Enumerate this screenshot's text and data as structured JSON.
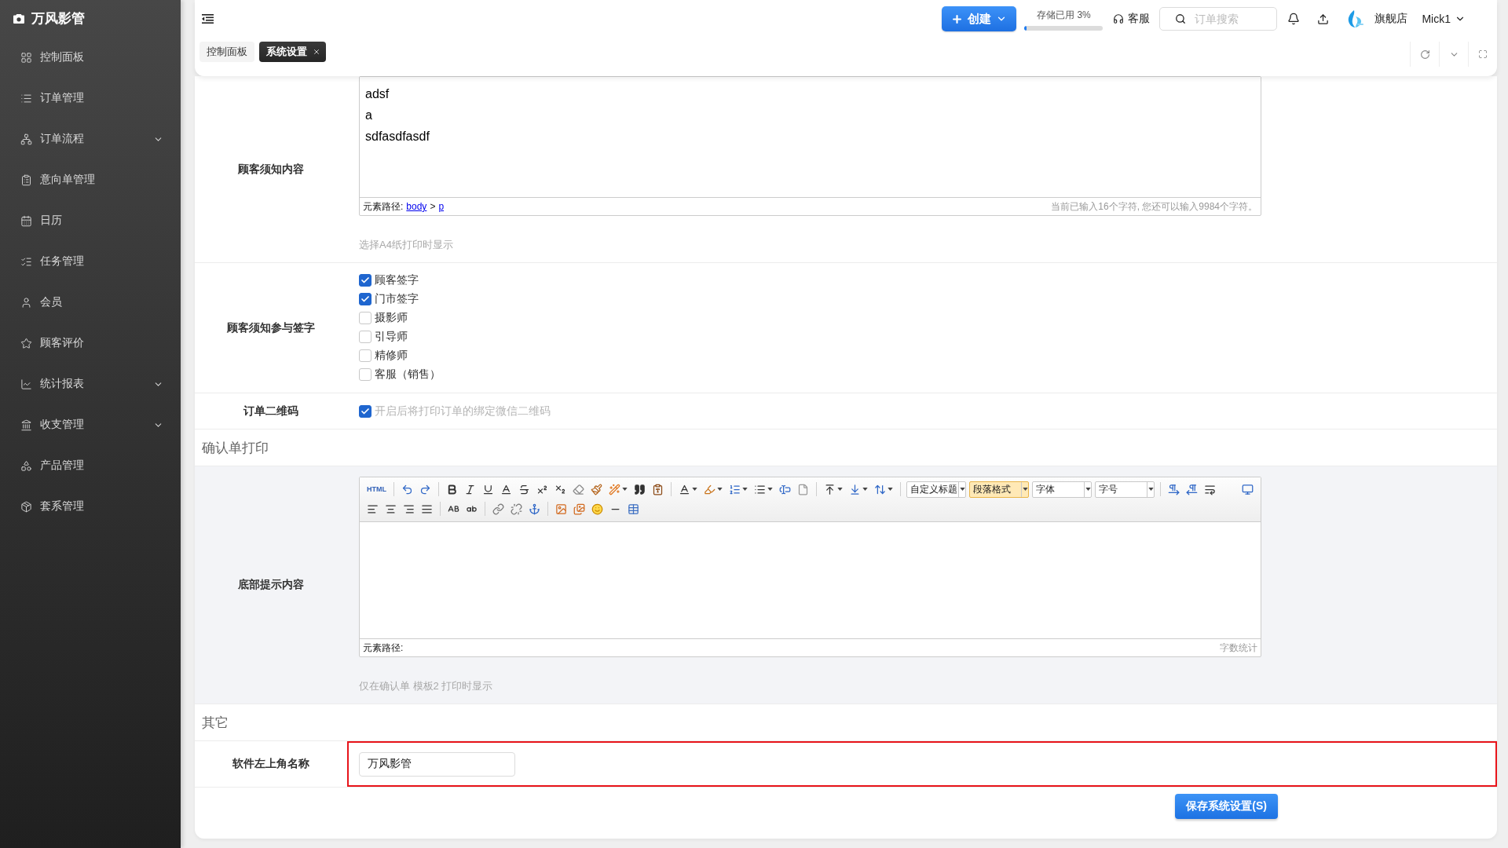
{
  "app": {
    "title": "万风影管"
  },
  "sidebar": {
    "items": [
      {
        "label": "控制面板",
        "expandable": false,
        "selected": false
      },
      {
        "label": "订单管理",
        "expandable": false,
        "selected": false
      },
      {
        "label": "订单流程",
        "expandable": true,
        "selected": false
      },
      {
        "label": "意向单管理",
        "expandable": false,
        "selected": false
      },
      {
        "label": "日历",
        "expandable": false,
        "selected": false
      },
      {
        "label": "任务管理",
        "expandable": false,
        "selected": false
      },
      {
        "label": "会员",
        "expandable": false,
        "selected": false
      },
      {
        "label": "顾客评价",
        "expandable": false,
        "selected": false
      },
      {
        "label": "统计报表",
        "expandable": true,
        "selected": false
      },
      {
        "label": "收支管理",
        "expandable": true,
        "selected": false
      },
      {
        "label": "产品管理",
        "expandable": false,
        "selected": false
      },
      {
        "label": "套系管理",
        "expandable": false,
        "selected": false
      }
    ]
  },
  "header": {
    "create_button": {
      "label": "创建"
    },
    "storage": {
      "label": "存储已用 3%",
      "level": 0.03
    },
    "support": {
      "label": "客服"
    },
    "search": {
      "placeholder": "订单搜索"
    },
    "store": {
      "name": "旗舰店"
    },
    "user": {
      "name": "Mick1"
    }
  },
  "tabs": [
    {
      "label": "控制面板",
      "selected": false,
      "closable": false
    },
    {
      "label": "系统设置",
      "selected": true,
      "closable": true
    }
  ],
  "form": {
    "sections": [
      {
        "rows": [
          {
            "kind": "editor",
            "label": "顾客须知内容",
            "hovered": false,
            "editor": {
              "content_lines": [
                "adsf",
                "a",
                "sdfasdfasdf"
              ],
              "path_label": "元素路径:",
              "path": [
                "body",
                "p"
              ],
              "path_separator": ">",
              "status": "当前已输入16个字符, 您还可以输入9984个字符。"
            },
            "hint": "选择A4纸打印时显示"
          },
          {
            "kind": "checkboxes",
            "label": "顾客须知参与签字",
            "hovered": false,
            "options": [
              {
                "label": "顾客签字",
                "checked": true
              },
              {
                "label": "门市签字",
                "checked": true
              },
              {
                "label": "摄影师",
                "checked": false
              },
              {
                "label": "引导师",
                "checked": false
              },
              {
                "label": "精修师",
                "checked": false
              },
              {
                "label": "客服（销售）",
                "checked": false
              }
            ]
          },
          {
            "kind": "checkbox",
            "label": "订单二维码",
            "hovered": false,
            "option": {
              "label": "开启后将打印订单的绑定微信二维码",
              "checked": true
            }
          }
        ]
      },
      {
        "heading": "确认单打印",
        "rows": [
          {
            "kind": "editor",
            "label": "底部提示内容",
            "hovered": true,
            "editor": {
              "toolbar": {
                "source_label": "HTML",
                "selects": [
                  {
                    "label": "自定义标题",
                    "highlighted": false
                  },
                  {
                    "label": "段落格式",
                    "highlighted": true
                  },
                  {
                    "label": "字体",
                    "highlighted": false
                  },
                  {
                    "label": "字号",
                    "highlighted": false
                  }
                ]
              },
              "path_label": "元素路径:",
              "status": "字数统计"
            },
            "hint": "仅在确认单 模板2 打印时显示"
          }
        ]
      },
      {
        "heading": "其它",
        "rows": [
          {
            "kind": "text",
            "label": "软件左上角名称",
            "hovered": false,
            "highlighted": true,
            "value": "万风影管"
          }
        ]
      }
    ]
  },
  "save_button": {
    "label": "保存系统设置(S)"
  }
}
